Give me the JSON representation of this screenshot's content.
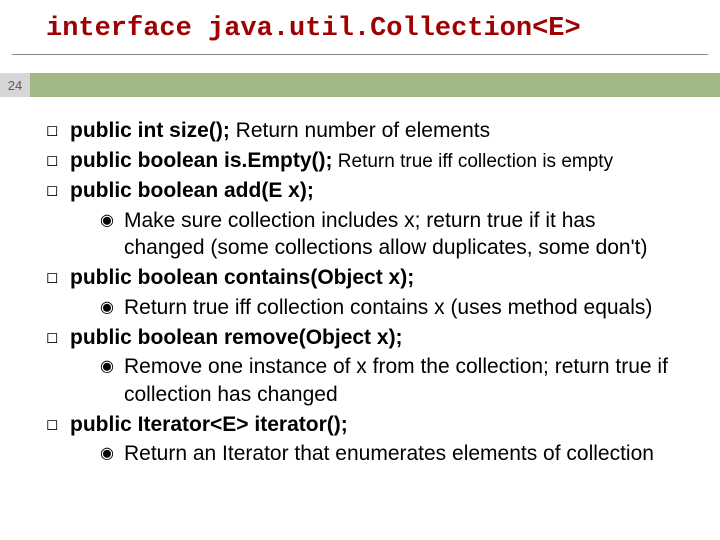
{
  "slide_number": "24",
  "title_pieces": {
    "p1": "interface java.",
    "p2": "util.",
    "p3": "Collection<E>"
  },
  "bullets": {
    "b1_sig": "public int size();",
    "b1_desc": " Return number of elements",
    "b2_sig": "public boolean is.Empty();",
    "b2_desc": " Return true iff collection is empty",
    "b3_sig": "public boolean add(E x);",
    "b3_sub": "Make sure collection includes x; return true if it has changed (some collections allow duplicates, some don't)",
    "b4_sig": "public boolean contains(Object x);",
    "b4_sub": "Return true iff collection contains x (uses method equals)",
    "b5_sig": "public boolean remove(Object x);",
    "b5_sub": "Remove one instance of x from the collection; return true if collection has changed",
    "b6_sig": "public Iterator<E> iterator();",
    "b6_sub": "Return an Iterator that enumerates elements of collection"
  }
}
